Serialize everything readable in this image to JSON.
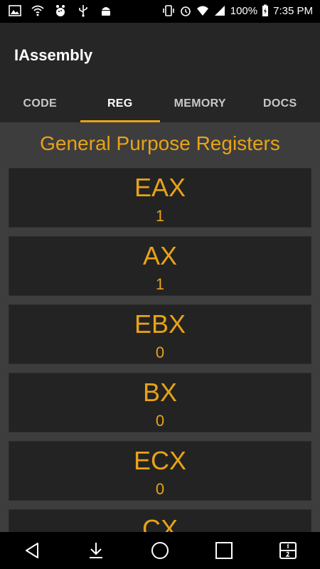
{
  "status_bar": {
    "battery_percent": "100%",
    "time": "7:35 PM",
    "left_icons": [
      "image-icon",
      "wifi-icon",
      "bowling-icon",
      "usb-icon",
      "android-icon"
    ],
    "right_icons": [
      "vibrate-icon",
      "alarm-icon",
      "wifi-signal-icon",
      "cell-signal-icon",
      "battery-charging-icon"
    ]
  },
  "app": {
    "title": "IAssembly"
  },
  "tabs": [
    {
      "label": "CODE",
      "active": false
    },
    {
      "label": "REG",
      "active": true
    },
    {
      "label": "MEMORY",
      "active": false
    },
    {
      "label": "DOCS",
      "active": false
    }
  ],
  "section": {
    "title": "General Purpose Registers"
  },
  "registers": [
    {
      "name": "EAX",
      "value": "1"
    },
    {
      "name": "AX",
      "value": "1"
    },
    {
      "name": "EBX",
      "value": "0"
    },
    {
      "name": "BX",
      "value": "0"
    },
    {
      "name": "ECX",
      "value": "0"
    },
    {
      "name": "CX",
      "value": ""
    }
  ],
  "nav_bar": [
    "back-icon",
    "download-icon",
    "home-icon",
    "recents-icon",
    "dual-window-icon"
  ],
  "colors": {
    "accent": "#e8a317",
    "appbar": "#262626",
    "background": "#3d3d3d",
    "card": "#232323"
  }
}
